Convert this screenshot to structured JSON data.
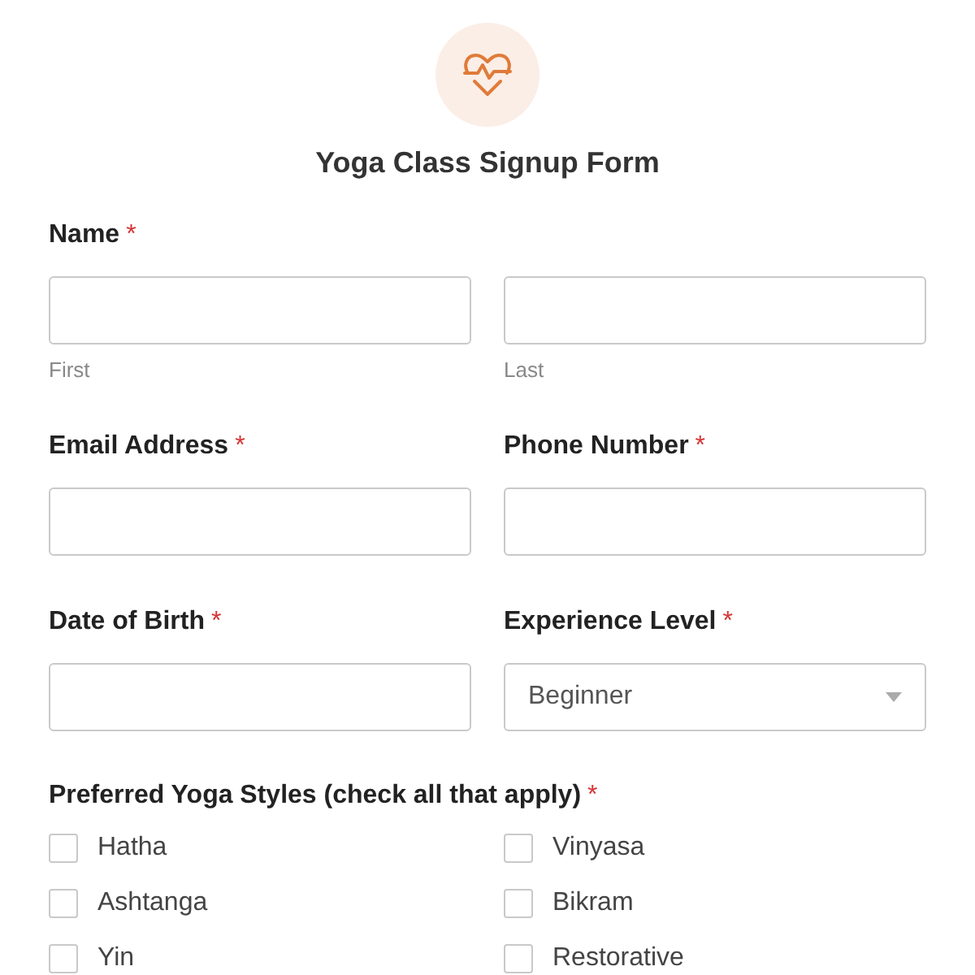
{
  "title": "Yoga Class Signup Form",
  "name_field": {
    "label": "Name",
    "required_mark": "*",
    "parts": [
      {
        "sublabel": "First"
      },
      {
        "sublabel": "Last"
      }
    ]
  },
  "field_rows": [
    [
      {
        "kind": "text",
        "label": "Email Address",
        "required_mark": "*"
      },
      {
        "kind": "text",
        "label": "Phone Number",
        "required_mark": "*"
      }
    ],
    [
      {
        "kind": "text",
        "label": "Date of Birth",
        "required_mark": "*"
      },
      {
        "kind": "select",
        "label": "Experience Level",
        "required_mark": "*",
        "value": "Beginner"
      }
    ]
  ],
  "styles": {
    "label": "Preferred Yoga Styles (check all that apply)",
    "required_mark": "*",
    "options": [
      {
        "label": "Hatha",
        "checked": false
      },
      {
        "label": "Vinyasa",
        "checked": false
      },
      {
        "label": "Ashtanga",
        "checked": false
      },
      {
        "label": "Bikram",
        "checked": false
      },
      {
        "label": "Yin",
        "checked": false
      },
      {
        "label": "Restorative",
        "checked": false
      }
    ]
  }
}
